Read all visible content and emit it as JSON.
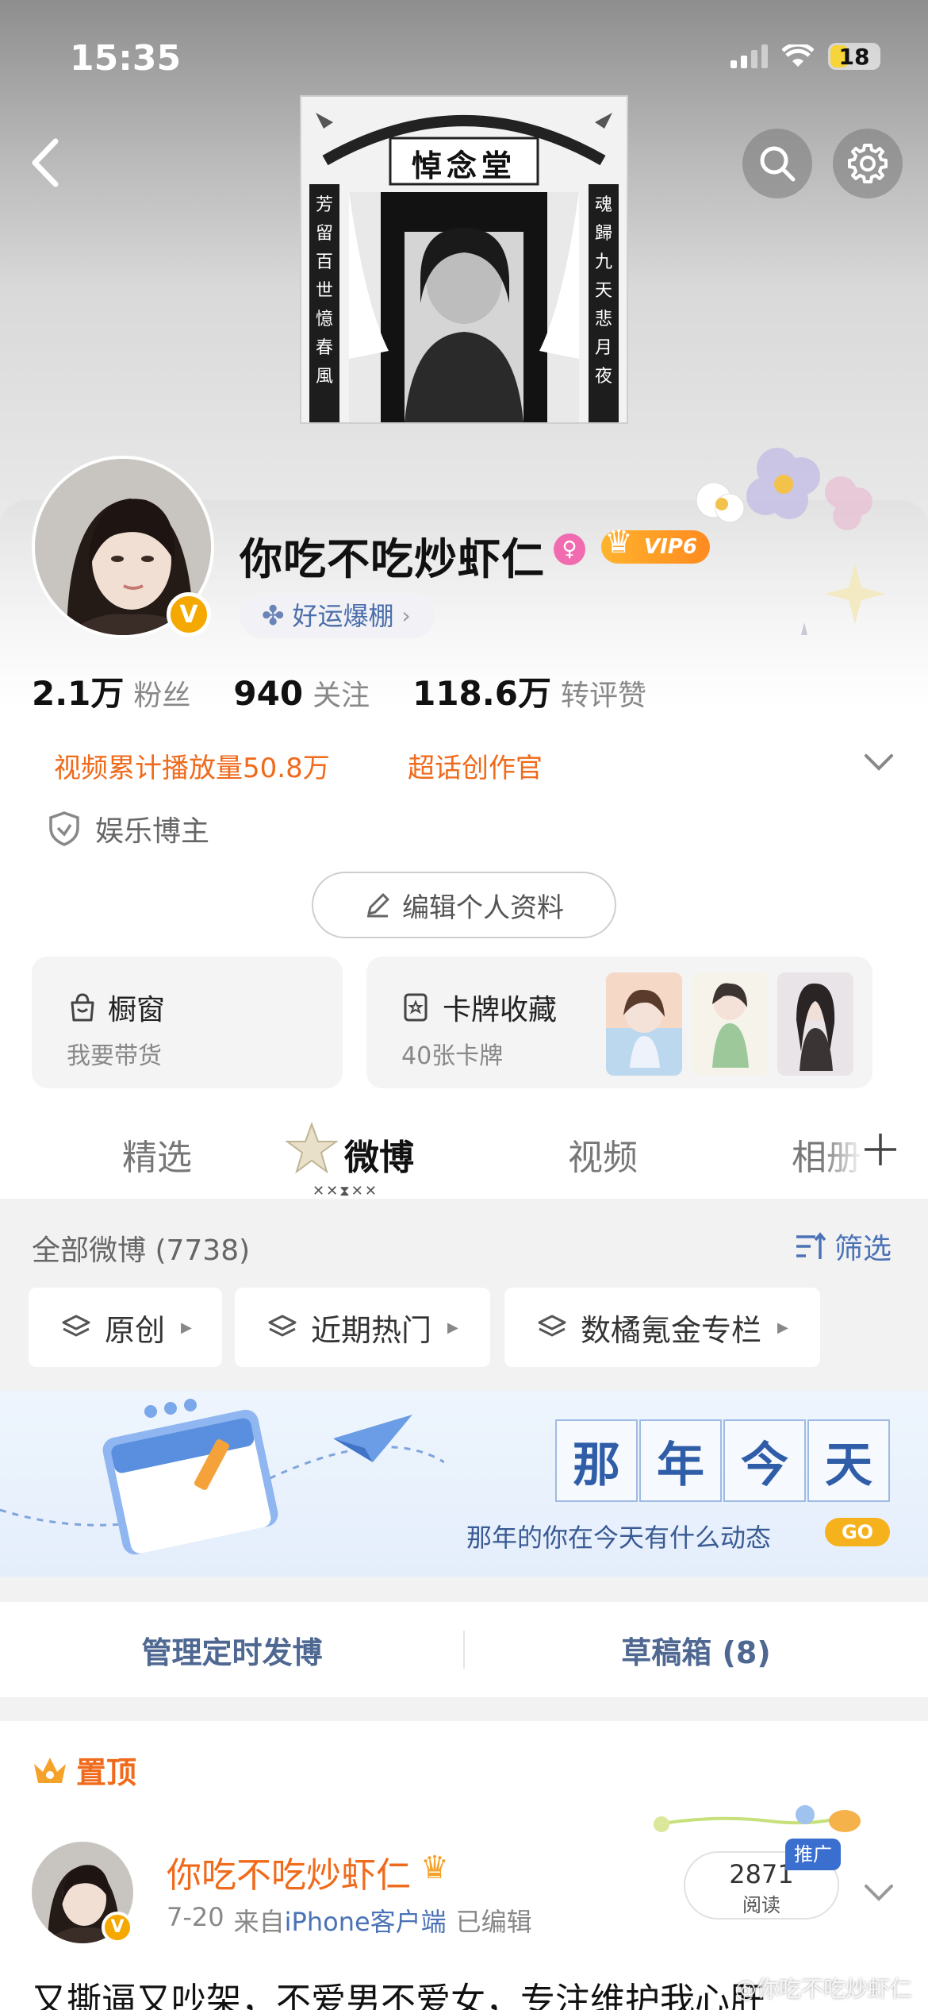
{
  "status_bar": {
    "time": "15:35",
    "battery": "18"
  },
  "memorial": {
    "title": "悼念堂",
    "left_couplet": [
      "芳",
      "留",
      "百",
      "世",
      "憶",
      "春",
      "風"
    ],
    "right_couplet": [
      "魂",
      "歸",
      "九",
      "天",
      "悲",
      "月",
      "夜"
    ]
  },
  "profile": {
    "username": "你吃不吃炒虾仁",
    "vip_label": "VIP6",
    "luck_label": "好运爆棚",
    "stats": [
      {
        "num": "2.1万",
        "label": "粉丝"
      },
      {
        "num": "940",
        "label": "关注"
      },
      {
        "num": "118.6万",
        "label": "转评赞"
      }
    ],
    "highlight1": "视频累计播放量50.8万",
    "highlight2": "超话创作官",
    "tag": "娱乐博主",
    "edit_label": "编辑个人资料"
  },
  "cards": {
    "shop": {
      "title": "橱窗",
      "sub": "我要带货"
    },
    "cardpack": {
      "title": "卡牌收藏",
      "sub": "40张卡牌"
    }
  },
  "tabs": [
    "精选",
    "微博",
    "视频",
    "相册"
  ],
  "feed": {
    "total": "全部微博 (7738)",
    "filter": "筛选",
    "chips": [
      "原创",
      "近期热门",
      "数橘氪金专栏"
    ]
  },
  "banner": {
    "chars": [
      "那",
      "年",
      "今",
      "天"
    ],
    "caption": "那年的你在今天有什么动态",
    "go": "GO"
  },
  "manage": {
    "schedule": "管理定时发博",
    "drafts": "草稿箱 (8)"
  },
  "post": {
    "pinned": "置顶",
    "author": "你吃不吃炒虾仁",
    "date": "7-20",
    "from_prefix": "来自",
    "source": "iPhone客户端",
    "edited": "已编辑",
    "reads": "2871",
    "reads_label": "阅读",
    "promo": "推广",
    "text": "又撕逼又吵架，不爱男不爱女，专注维护我心肝",
    "watermark": "@你吃不吃炒虾仁"
  },
  "colors": {
    "accent_orange": "#f06a1b",
    "link_blue": "#4b72b6",
    "vip_gold": "#f5a800"
  }
}
